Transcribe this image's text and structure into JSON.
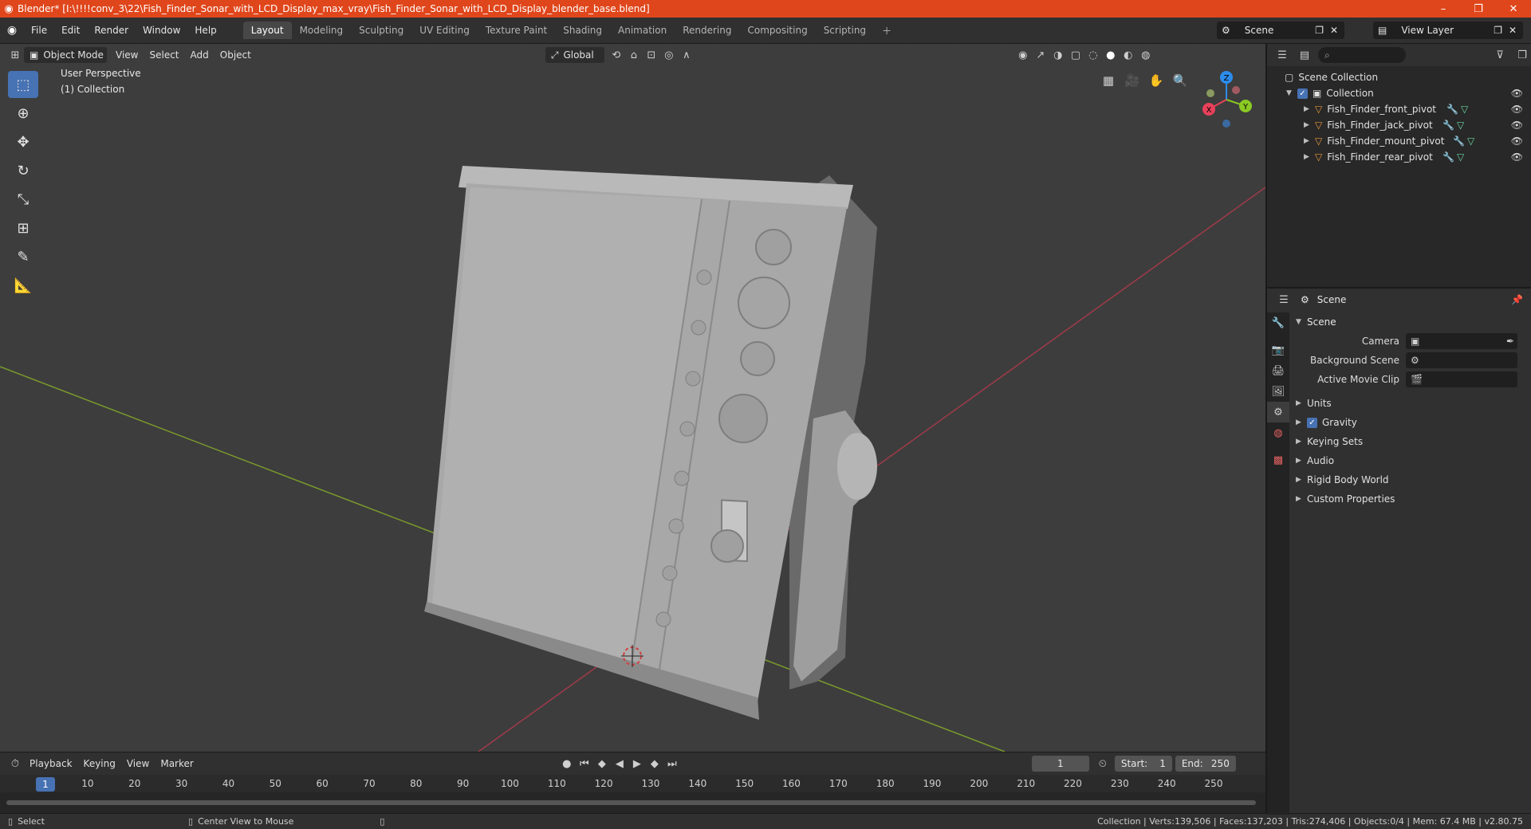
{
  "titlebar": {
    "title": "Blender* [I:\\!!!!conv_3\\22\\Fish_Finder_Sonar_with_LCD_Display_max_vray\\Fish_Finder_Sonar_with_LCD_Display_blender_base.blend]",
    "minimize": "–",
    "maximize": "❐",
    "close": "✕"
  },
  "menu": {
    "file": "File",
    "edit": "Edit",
    "render": "Render",
    "window": "Window",
    "help": "Help"
  },
  "workspaces": [
    "Layout",
    "Modeling",
    "Sculpting",
    "UV Editing",
    "Texture Paint",
    "Shading",
    "Animation",
    "Rendering",
    "Compositing",
    "Scripting"
  ],
  "scene_name": "Scene",
  "view_layer": "View Layer",
  "viewport": {
    "mode": "Object Mode",
    "menus": [
      "View",
      "Select",
      "Add",
      "Object"
    ],
    "transform_orientation": "Global",
    "perspective_label": "User Perspective",
    "collection_label": "(1) Collection",
    "gizmo": {
      "z": "Z",
      "y": "Y",
      "x": "X"
    }
  },
  "timeline": {
    "menus": [
      "Playback",
      "Keying",
      "View",
      "Marker"
    ],
    "current_frame": "1",
    "start_label": "Start:",
    "start": "1",
    "end_label": "End:",
    "end": "250",
    "ticks": [
      "1",
      "10",
      "20",
      "30",
      "40",
      "50",
      "60",
      "70",
      "80",
      "90",
      "100",
      "110",
      "120",
      "130",
      "140",
      "150",
      "160",
      "170",
      "180",
      "190",
      "200",
      "210",
      "220",
      "230",
      "240",
      "250"
    ]
  },
  "statusbar": {
    "select": "Select",
    "center_view": "Center View to Mouse",
    "stats": "Collection | Verts:139,506 | Faces:137,203 | Tris:274,406 | Objects:0/4 | Mem: 67.4 MB | v2.80.75"
  },
  "outliner": {
    "root": "Scene Collection",
    "collection": "Collection",
    "objects": [
      "Fish_Finder_front_pivot",
      "Fish_Finder_jack_pivot",
      "Fish_Finder_mount_pivot",
      "Fish_Finder_rear_pivot"
    ]
  },
  "properties": {
    "header": "Scene",
    "panel": "Scene",
    "camera_label": "Camera",
    "background_label": "Background Scene",
    "movieclip_label": "Active Movie Clip",
    "subpanels": {
      "units": "Units",
      "gravity": "Gravity",
      "keying_sets": "Keying Sets",
      "audio": "Audio",
      "rigid_body": "Rigid Body World",
      "custom_props": "Custom Properties"
    }
  },
  "colors": {
    "accent": "#4772b3",
    "titlebar": "#e0461b",
    "x_axis": "#e8415a",
    "y_axis": "#8bc924",
    "z_axis": "#2d8ceb"
  }
}
